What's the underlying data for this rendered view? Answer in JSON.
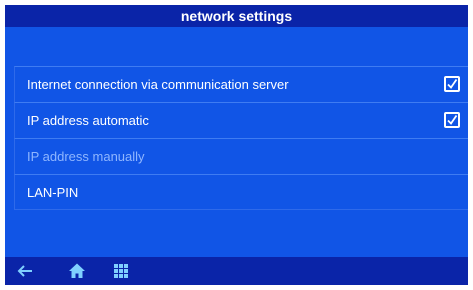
{
  "header": {
    "title": "network settings"
  },
  "settings": [
    {
      "label": "Internet connection via communication server",
      "checked": true,
      "enabled": true
    },
    {
      "label": "IP address automatic",
      "checked": true,
      "enabled": true
    },
    {
      "label": "IP address manually",
      "checked": false,
      "enabled": false
    },
    {
      "label": "LAN-PIN",
      "checked": false,
      "enabled": true
    }
  ],
  "bottom_nav": [
    {
      "icon": "back-arrow-icon"
    },
    {
      "icon": "home-icon"
    },
    {
      "icon": "grid-menu-icon"
    }
  ],
  "colors": {
    "screen_bg": "#1155e6",
    "bar_bg": "#0a24a8",
    "disabled_text": "#8fb6ff",
    "nav_icon": "#7fd0ff"
  }
}
